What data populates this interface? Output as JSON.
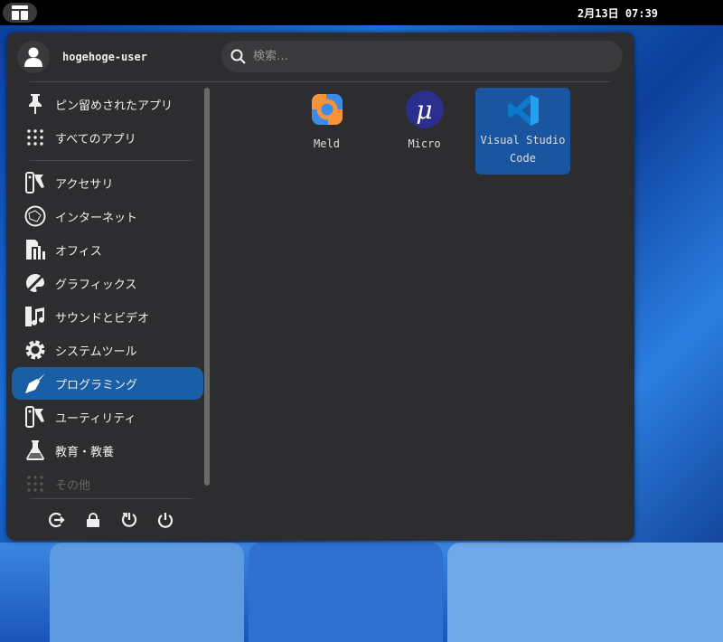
{
  "topbar": {
    "clock": "2月13日 07:39"
  },
  "user": {
    "name": "hogehoge-user"
  },
  "search": {
    "placeholder": "検索…"
  },
  "sidebar": {
    "items": [
      {
        "label": "ピン留めされたアプリ",
        "icon": "pin-icon"
      },
      {
        "label": "すべてのアプリ",
        "icon": "grid-icon"
      },
      {
        "label": "アクセサリ",
        "icon": "accessories-icon"
      },
      {
        "label": "インターネット",
        "icon": "internet-icon"
      },
      {
        "label": "オフィス",
        "icon": "office-icon"
      },
      {
        "label": "グラフィックス",
        "icon": "graphics-icon"
      },
      {
        "label": "サウンドとビデオ",
        "icon": "multimedia-icon"
      },
      {
        "label": "システムツール",
        "icon": "gear-icon"
      },
      {
        "label": "プログラミング",
        "icon": "trowel-icon"
      },
      {
        "label": "ユーティリティ",
        "icon": "utilities-icon"
      },
      {
        "label": "教育・教養",
        "icon": "flask-icon"
      },
      {
        "label": "その他",
        "icon": "grid-icon"
      }
    ],
    "selected": "プログラミング"
  },
  "apps": [
    {
      "name": "Meld",
      "icon": "meld-icon"
    },
    {
      "name": "Micro",
      "icon": "micro-icon",
      "glyph": "μ"
    },
    {
      "name": "Visual Studio Code",
      "line1": "Visual Studio",
      "line2": "Code",
      "icon": "vscode-icon"
    }
  ],
  "colors": {
    "accent": "#1a5fa5",
    "panel": "#2d2d2f"
  }
}
